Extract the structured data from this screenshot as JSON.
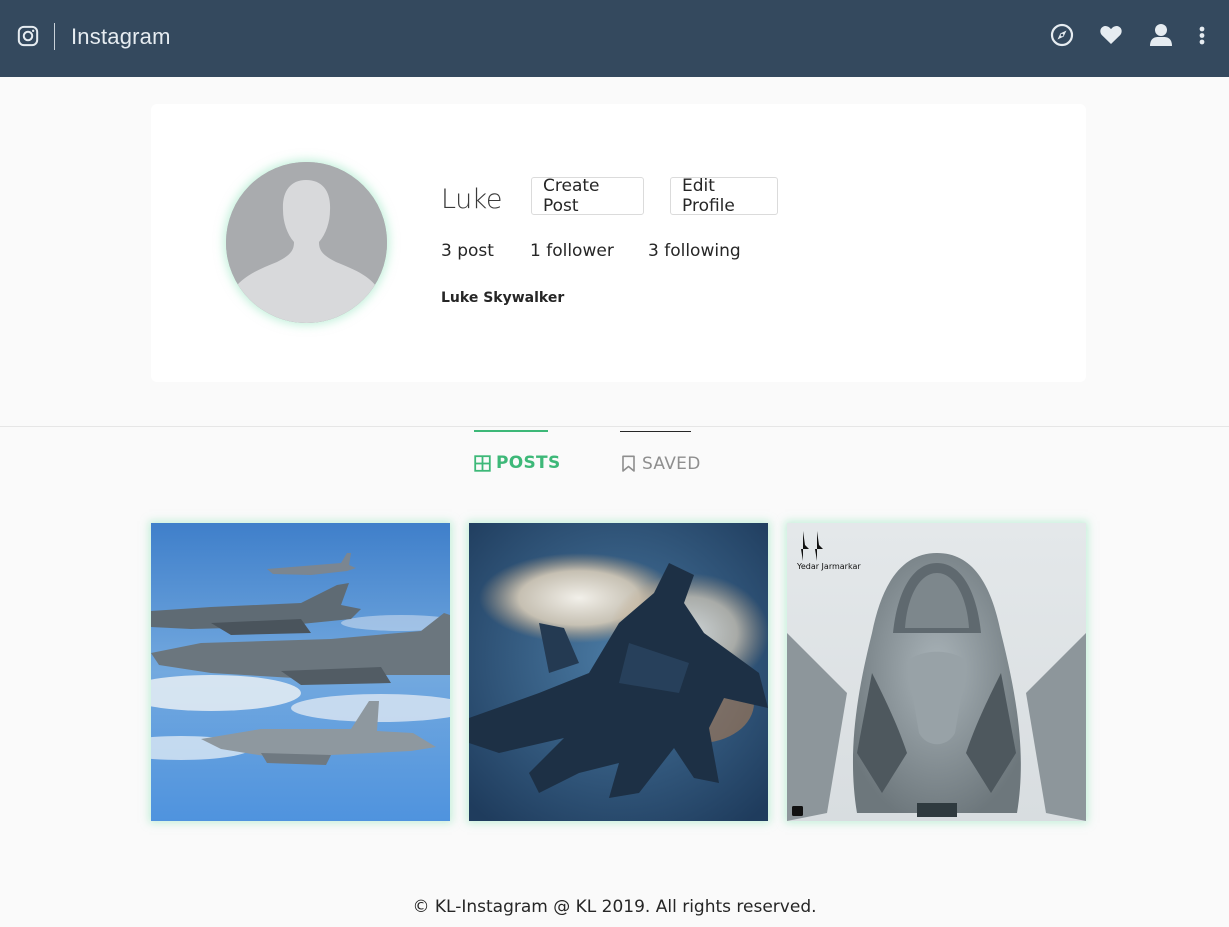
{
  "navbar": {
    "title": "Instagram",
    "logo_icon": "instagram-icon",
    "icons": [
      "compass-icon",
      "heart-icon",
      "user-icon",
      "more-vertical-icon"
    ],
    "background": "#34495e"
  },
  "profile": {
    "username": "Luke",
    "create_post_label": "Create Post",
    "edit_profile_label": "Edit Profile",
    "posts_count": "3 post",
    "followers_count": "1 follower",
    "following_count": "3 following",
    "full_name": "Luke Skywalker",
    "avatar_icon": "default-avatar-icon"
  },
  "tabs": {
    "posts_label": "POSTS",
    "saved_label": "SAVED",
    "active": "posts",
    "accent": "#3db878"
  },
  "posts": [
    {
      "name": "post-formation-flight"
    },
    {
      "name": "post-jet-vapor"
    },
    {
      "name": "post-stealth-fighter",
      "watermark": "Yedar Jarmarkar"
    }
  ],
  "footer": {
    "text": "© KL-Instagram @ KL 2019. All rights reserved."
  }
}
